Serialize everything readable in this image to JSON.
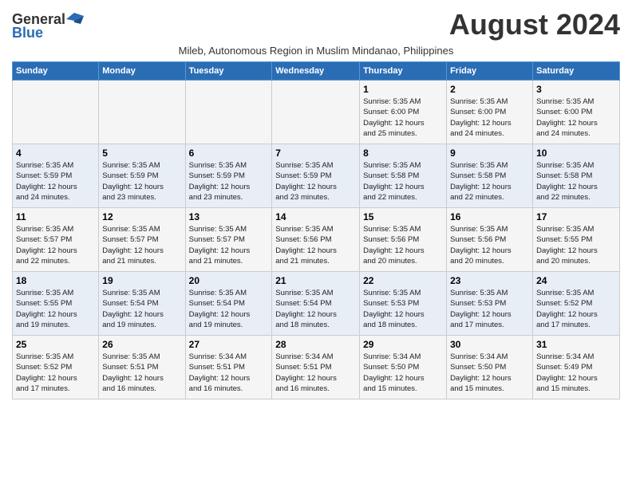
{
  "header": {
    "logo_general": "General",
    "logo_blue": "Blue",
    "month_title": "August 2024",
    "subtitle": "Mileb, Autonomous Region in Muslim Mindanao, Philippines"
  },
  "days_of_week": [
    "Sunday",
    "Monday",
    "Tuesday",
    "Wednesday",
    "Thursday",
    "Friday",
    "Saturday"
  ],
  "weeks": [
    [
      {
        "day": "",
        "info": ""
      },
      {
        "day": "",
        "info": ""
      },
      {
        "day": "",
        "info": ""
      },
      {
        "day": "",
        "info": ""
      },
      {
        "day": "1",
        "info": "Sunrise: 5:35 AM\nSunset: 6:00 PM\nDaylight: 12 hours\nand 25 minutes."
      },
      {
        "day": "2",
        "info": "Sunrise: 5:35 AM\nSunset: 6:00 PM\nDaylight: 12 hours\nand 24 minutes."
      },
      {
        "day": "3",
        "info": "Sunrise: 5:35 AM\nSunset: 6:00 PM\nDaylight: 12 hours\nand 24 minutes."
      }
    ],
    [
      {
        "day": "4",
        "info": "Sunrise: 5:35 AM\nSunset: 5:59 PM\nDaylight: 12 hours\nand 24 minutes."
      },
      {
        "day": "5",
        "info": "Sunrise: 5:35 AM\nSunset: 5:59 PM\nDaylight: 12 hours\nand 23 minutes."
      },
      {
        "day": "6",
        "info": "Sunrise: 5:35 AM\nSunset: 5:59 PM\nDaylight: 12 hours\nand 23 minutes."
      },
      {
        "day": "7",
        "info": "Sunrise: 5:35 AM\nSunset: 5:59 PM\nDaylight: 12 hours\nand 23 minutes."
      },
      {
        "day": "8",
        "info": "Sunrise: 5:35 AM\nSunset: 5:58 PM\nDaylight: 12 hours\nand 22 minutes."
      },
      {
        "day": "9",
        "info": "Sunrise: 5:35 AM\nSunset: 5:58 PM\nDaylight: 12 hours\nand 22 minutes."
      },
      {
        "day": "10",
        "info": "Sunrise: 5:35 AM\nSunset: 5:58 PM\nDaylight: 12 hours\nand 22 minutes."
      }
    ],
    [
      {
        "day": "11",
        "info": "Sunrise: 5:35 AM\nSunset: 5:57 PM\nDaylight: 12 hours\nand 22 minutes."
      },
      {
        "day": "12",
        "info": "Sunrise: 5:35 AM\nSunset: 5:57 PM\nDaylight: 12 hours\nand 21 minutes."
      },
      {
        "day": "13",
        "info": "Sunrise: 5:35 AM\nSunset: 5:57 PM\nDaylight: 12 hours\nand 21 minutes."
      },
      {
        "day": "14",
        "info": "Sunrise: 5:35 AM\nSunset: 5:56 PM\nDaylight: 12 hours\nand 21 minutes."
      },
      {
        "day": "15",
        "info": "Sunrise: 5:35 AM\nSunset: 5:56 PM\nDaylight: 12 hours\nand 20 minutes."
      },
      {
        "day": "16",
        "info": "Sunrise: 5:35 AM\nSunset: 5:56 PM\nDaylight: 12 hours\nand 20 minutes."
      },
      {
        "day": "17",
        "info": "Sunrise: 5:35 AM\nSunset: 5:55 PM\nDaylight: 12 hours\nand 20 minutes."
      }
    ],
    [
      {
        "day": "18",
        "info": "Sunrise: 5:35 AM\nSunset: 5:55 PM\nDaylight: 12 hours\nand 19 minutes."
      },
      {
        "day": "19",
        "info": "Sunrise: 5:35 AM\nSunset: 5:54 PM\nDaylight: 12 hours\nand 19 minutes."
      },
      {
        "day": "20",
        "info": "Sunrise: 5:35 AM\nSunset: 5:54 PM\nDaylight: 12 hours\nand 19 minutes."
      },
      {
        "day": "21",
        "info": "Sunrise: 5:35 AM\nSunset: 5:54 PM\nDaylight: 12 hours\nand 18 minutes."
      },
      {
        "day": "22",
        "info": "Sunrise: 5:35 AM\nSunset: 5:53 PM\nDaylight: 12 hours\nand 18 minutes."
      },
      {
        "day": "23",
        "info": "Sunrise: 5:35 AM\nSunset: 5:53 PM\nDaylight: 12 hours\nand 17 minutes."
      },
      {
        "day": "24",
        "info": "Sunrise: 5:35 AM\nSunset: 5:52 PM\nDaylight: 12 hours\nand 17 minutes."
      }
    ],
    [
      {
        "day": "25",
        "info": "Sunrise: 5:35 AM\nSunset: 5:52 PM\nDaylight: 12 hours\nand 17 minutes."
      },
      {
        "day": "26",
        "info": "Sunrise: 5:35 AM\nSunset: 5:51 PM\nDaylight: 12 hours\nand 16 minutes."
      },
      {
        "day": "27",
        "info": "Sunrise: 5:34 AM\nSunset: 5:51 PM\nDaylight: 12 hours\nand 16 minutes."
      },
      {
        "day": "28",
        "info": "Sunrise: 5:34 AM\nSunset: 5:51 PM\nDaylight: 12 hours\nand 16 minutes."
      },
      {
        "day": "29",
        "info": "Sunrise: 5:34 AM\nSunset: 5:50 PM\nDaylight: 12 hours\nand 15 minutes."
      },
      {
        "day": "30",
        "info": "Sunrise: 5:34 AM\nSunset: 5:50 PM\nDaylight: 12 hours\nand 15 minutes."
      },
      {
        "day": "31",
        "info": "Sunrise: 5:34 AM\nSunset: 5:49 PM\nDaylight: 12 hours\nand 15 minutes."
      }
    ]
  ]
}
